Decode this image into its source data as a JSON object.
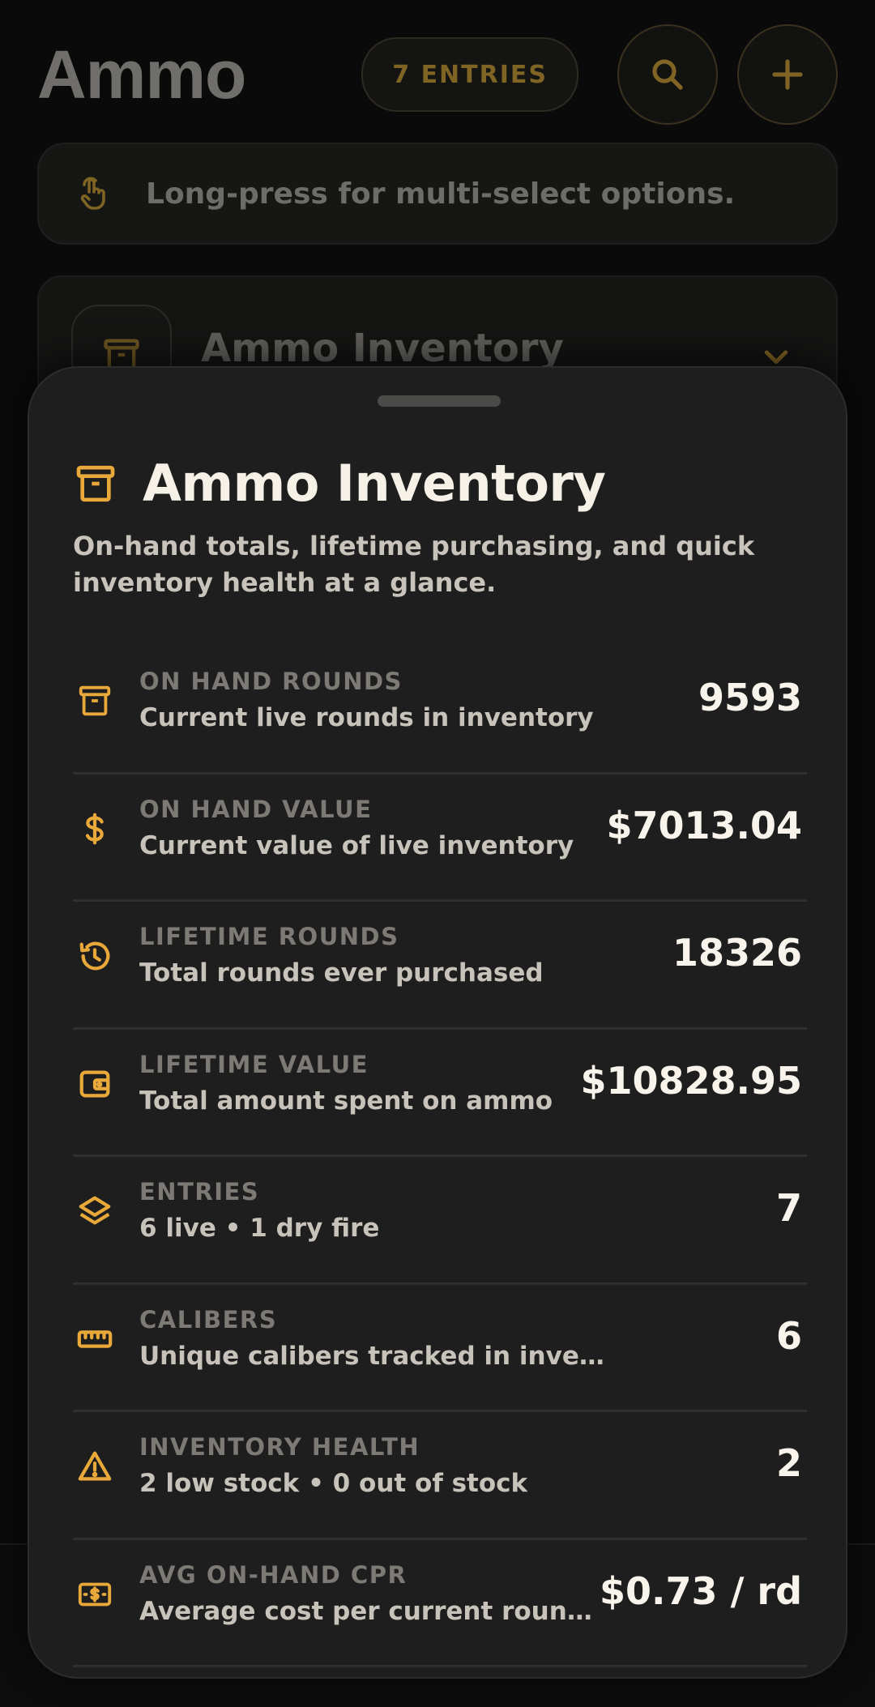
{
  "header": {
    "title": "Ammo",
    "entries_badge": "7 ENTRIES",
    "search_icon": "search-icon",
    "add_icon": "plus-icon"
  },
  "tip": {
    "icon": "touch-hand-icon",
    "text": "Long-press for multi-select options."
  },
  "background_card": {
    "icon": "archive-box-icon",
    "title": "Ammo Inventory",
    "chevron": "chevron-down-icon"
  },
  "sheet": {
    "icon": "archive-box-icon",
    "title": "Ammo Inventory",
    "description": "On-hand totals, lifetime purchasing, and quick inventory health at a glance.",
    "stats": [
      {
        "icon": "archive-box-icon",
        "label": "ON HAND ROUNDS",
        "sub": "Current live rounds in inventory",
        "value": "9593"
      },
      {
        "icon": "dollar-icon",
        "label": "ON HAND VALUE",
        "sub": "Current value of live inventory",
        "value": "$7013.04"
      },
      {
        "icon": "history-icon",
        "label": "LIFETIME ROUNDS",
        "sub": "Total rounds ever purchased",
        "value": "18326"
      },
      {
        "icon": "wallet-icon",
        "label": "LIFETIME VALUE",
        "sub": "Total amount spent on ammo",
        "value": "$10828.95"
      },
      {
        "icon": "layers-icon",
        "label": "ENTRIES",
        "sub": "6 live • 1 dry fire",
        "value": "7"
      },
      {
        "icon": "ruler-icon",
        "label": "CALIBERS",
        "sub": "Unique calibers tracked in inventory",
        "value": "6"
      },
      {
        "icon": "warning-icon",
        "label": "INVENTORY HEALTH",
        "sub": "2 low stock • 0 out of stock",
        "value": "2"
      },
      {
        "icon": "cash-icon",
        "label": "AVG ON-HAND CPR",
        "sub": "Average cost per current round on hand",
        "value": "$0.73 / rd"
      }
    ]
  },
  "colors": {
    "accent": "#e8a93a",
    "accent_dim": "#7f6424",
    "sheet_bg": "#1e1e1e",
    "page_bg": "#0a0a0a"
  }
}
